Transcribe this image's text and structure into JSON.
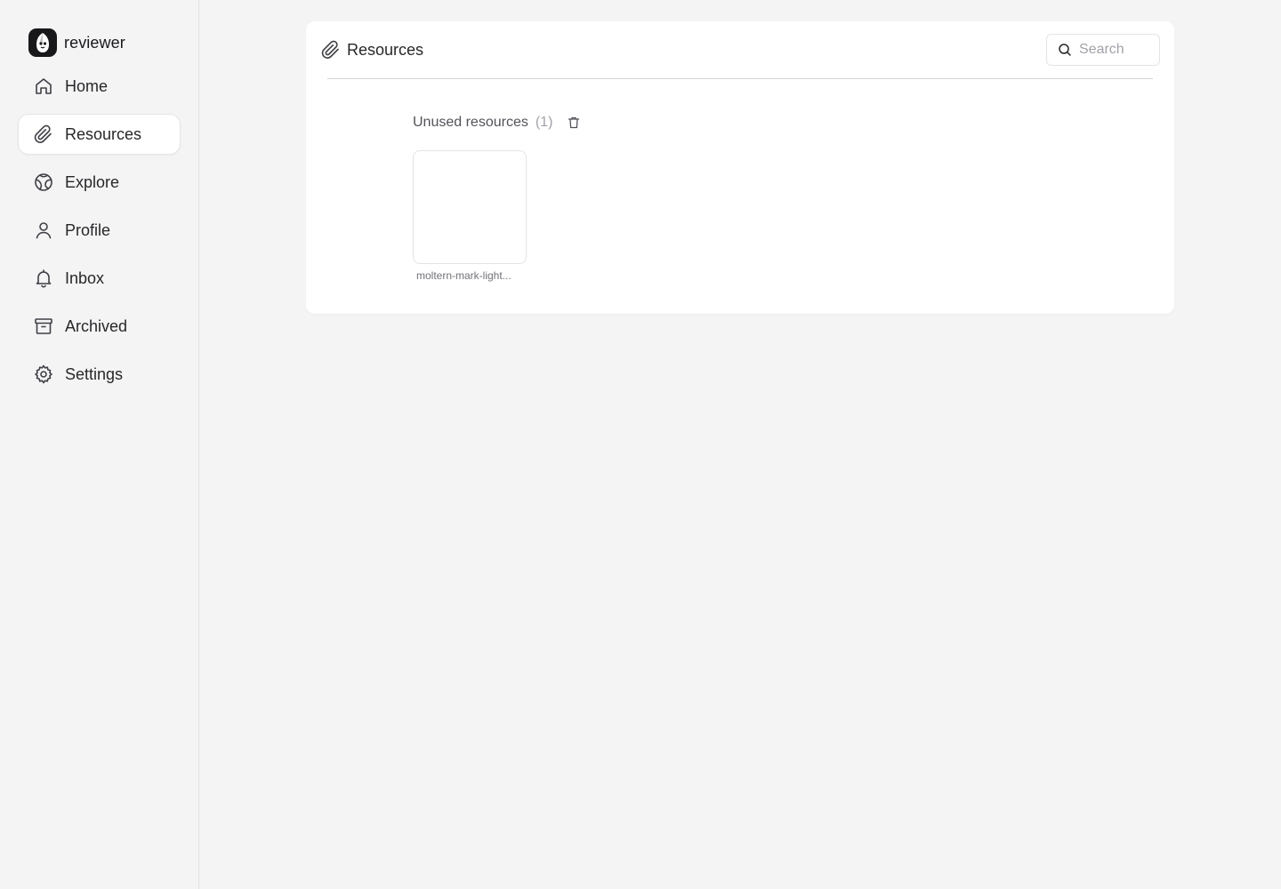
{
  "app": {
    "user_name": "reviewer"
  },
  "sidebar": {
    "items": [
      {
        "label": "Home",
        "icon": "home-icon"
      },
      {
        "label": "Resources",
        "icon": "paperclip-icon",
        "active": true
      },
      {
        "label": "Explore",
        "icon": "globe-icon"
      },
      {
        "label": "Profile",
        "icon": "user-icon"
      },
      {
        "label": "Inbox",
        "icon": "bell-icon"
      },
      {
        "label": "Archived",
        "icon": "archive-icon"
      },
      {
        "label": "Settings",
        "icon": "gear-icon"
      }
    ]
  },
  "main": {
    "title": "Resources",
    "search": {
      "placeholder": "Search",
      "value": ""
    },
    "unused": {
      "label": "Unused resources",
      "count": "(1)",
      "items": [
        {
          "name": "moltern-mark-light..."
        }
      ]
    }
  },
  "colors": {
    "background": "#f4f4f5",
    "card": "#ffffff",
    "text": "#27272a",
    "muted": "#a1a1aa"
  }
}
